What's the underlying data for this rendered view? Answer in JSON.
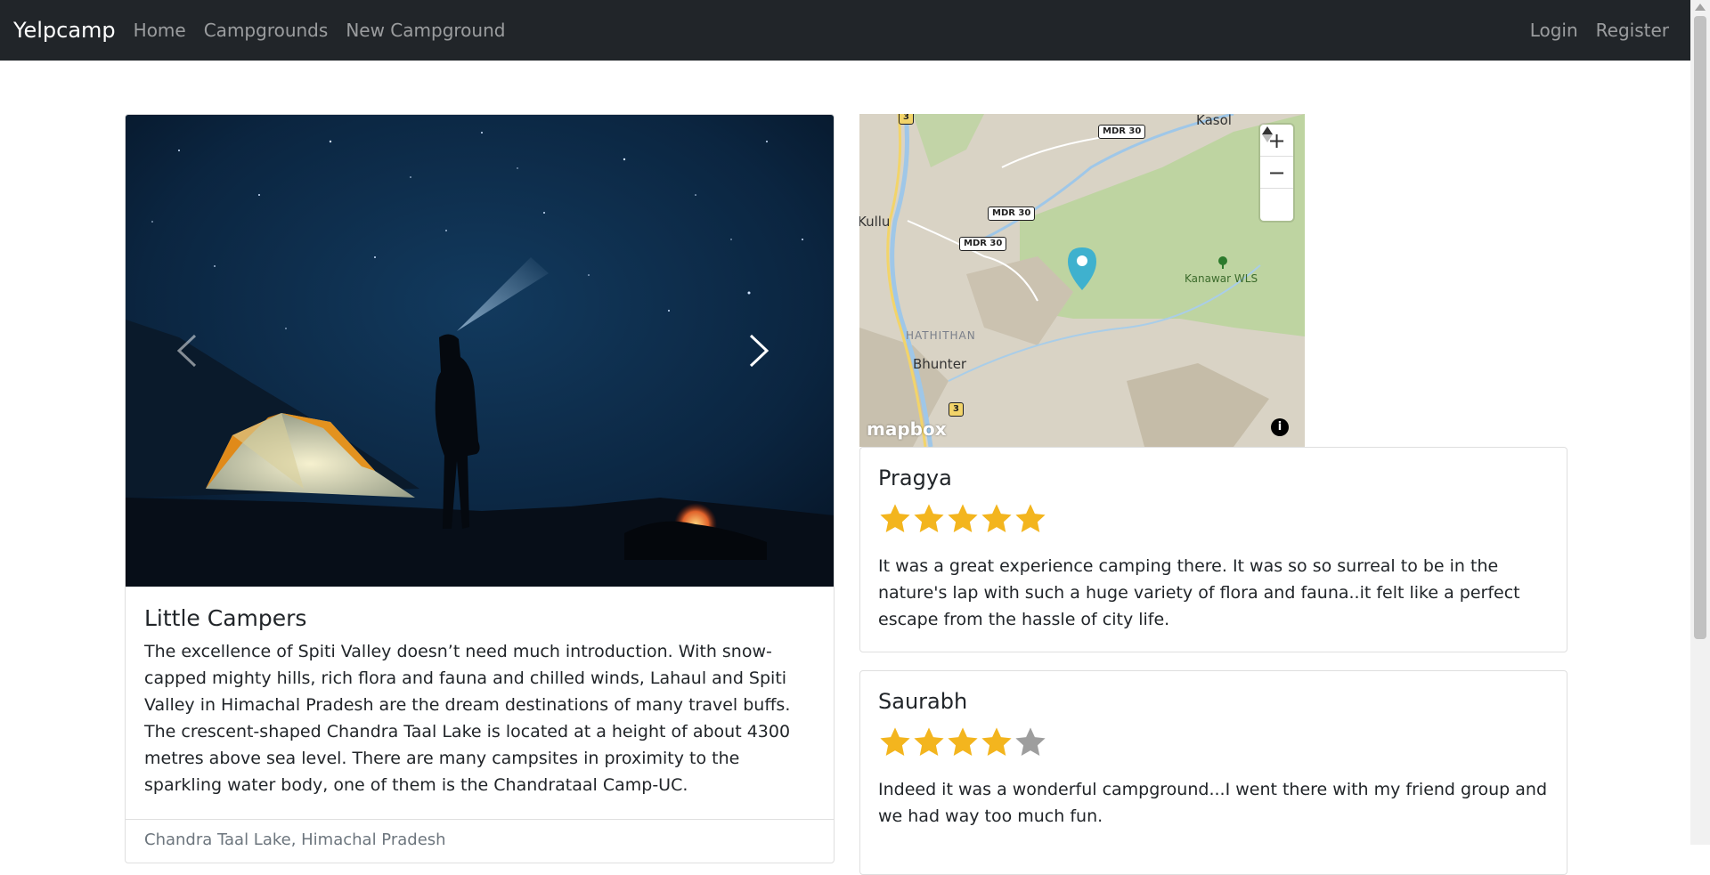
{
  "navbar": {
    "brand": "Yelpcamp",
    "links": [
      "Home",
      "Campgrounds",
      "New Campground"
    ],
    "right_links": [
      "Login",
      "Register"
    ]
  },
  "campground": {
    "title": "Little Campers",
    "description": "The excellence of Spiti Valley doesn’t need much introduction. With snow-capped mighty hills, rich flora and fauna and chilled winds, Lahaul and Spiti Valley in Himachal Pradesh are the dream destinations of many travel buffs. The crescent-shaped Chandra Taal Lake is located at a height of about 4300 metres above sea level. There are many campsites in proximity to the sparkling water body, one of them is the Chandrataal Camp-UC.",
    "location": "Chandra Taal Lake, Himachal Pradesh"
  },
  "map": {
    "labels": [
      "Kasol",
      "Kullu",
      "HATHITHAN",
      "Bhunter",
      "Kanawar WLS"
    ],
    "road_badges": [
      "MDR 30",
      "MDR 30",
      "MDR 30",
      "3",
      "3"
    ],
    "zoom_in": "+",
    "zoom_out": "−",
    "attribution_logo": "mapbox",
    "info_icon": "i"
  },
  "reviews": [
    {
      "author": "Pragya",
      "rating": 5,
      "text": "It was a great experience camping there. It was so so surreal to be in the nature's lap with such a huge variety of flora and fauna..it felt like a perfect escape from the hassle of city life."
    },
    {
      "author": "Saurabh",
      "rating": 4,
      "text": "Indeed it was a wonderful campground...I went there with my friend group and we had way too much fun."
    }
  ],
  "colors": {
    "navbar_bg": "#212529",
    "star_filled": "#f3b51e",
    "star_empty": "#9e9e9e",
    "map_pin": "#3fb1ce"
  }
}
